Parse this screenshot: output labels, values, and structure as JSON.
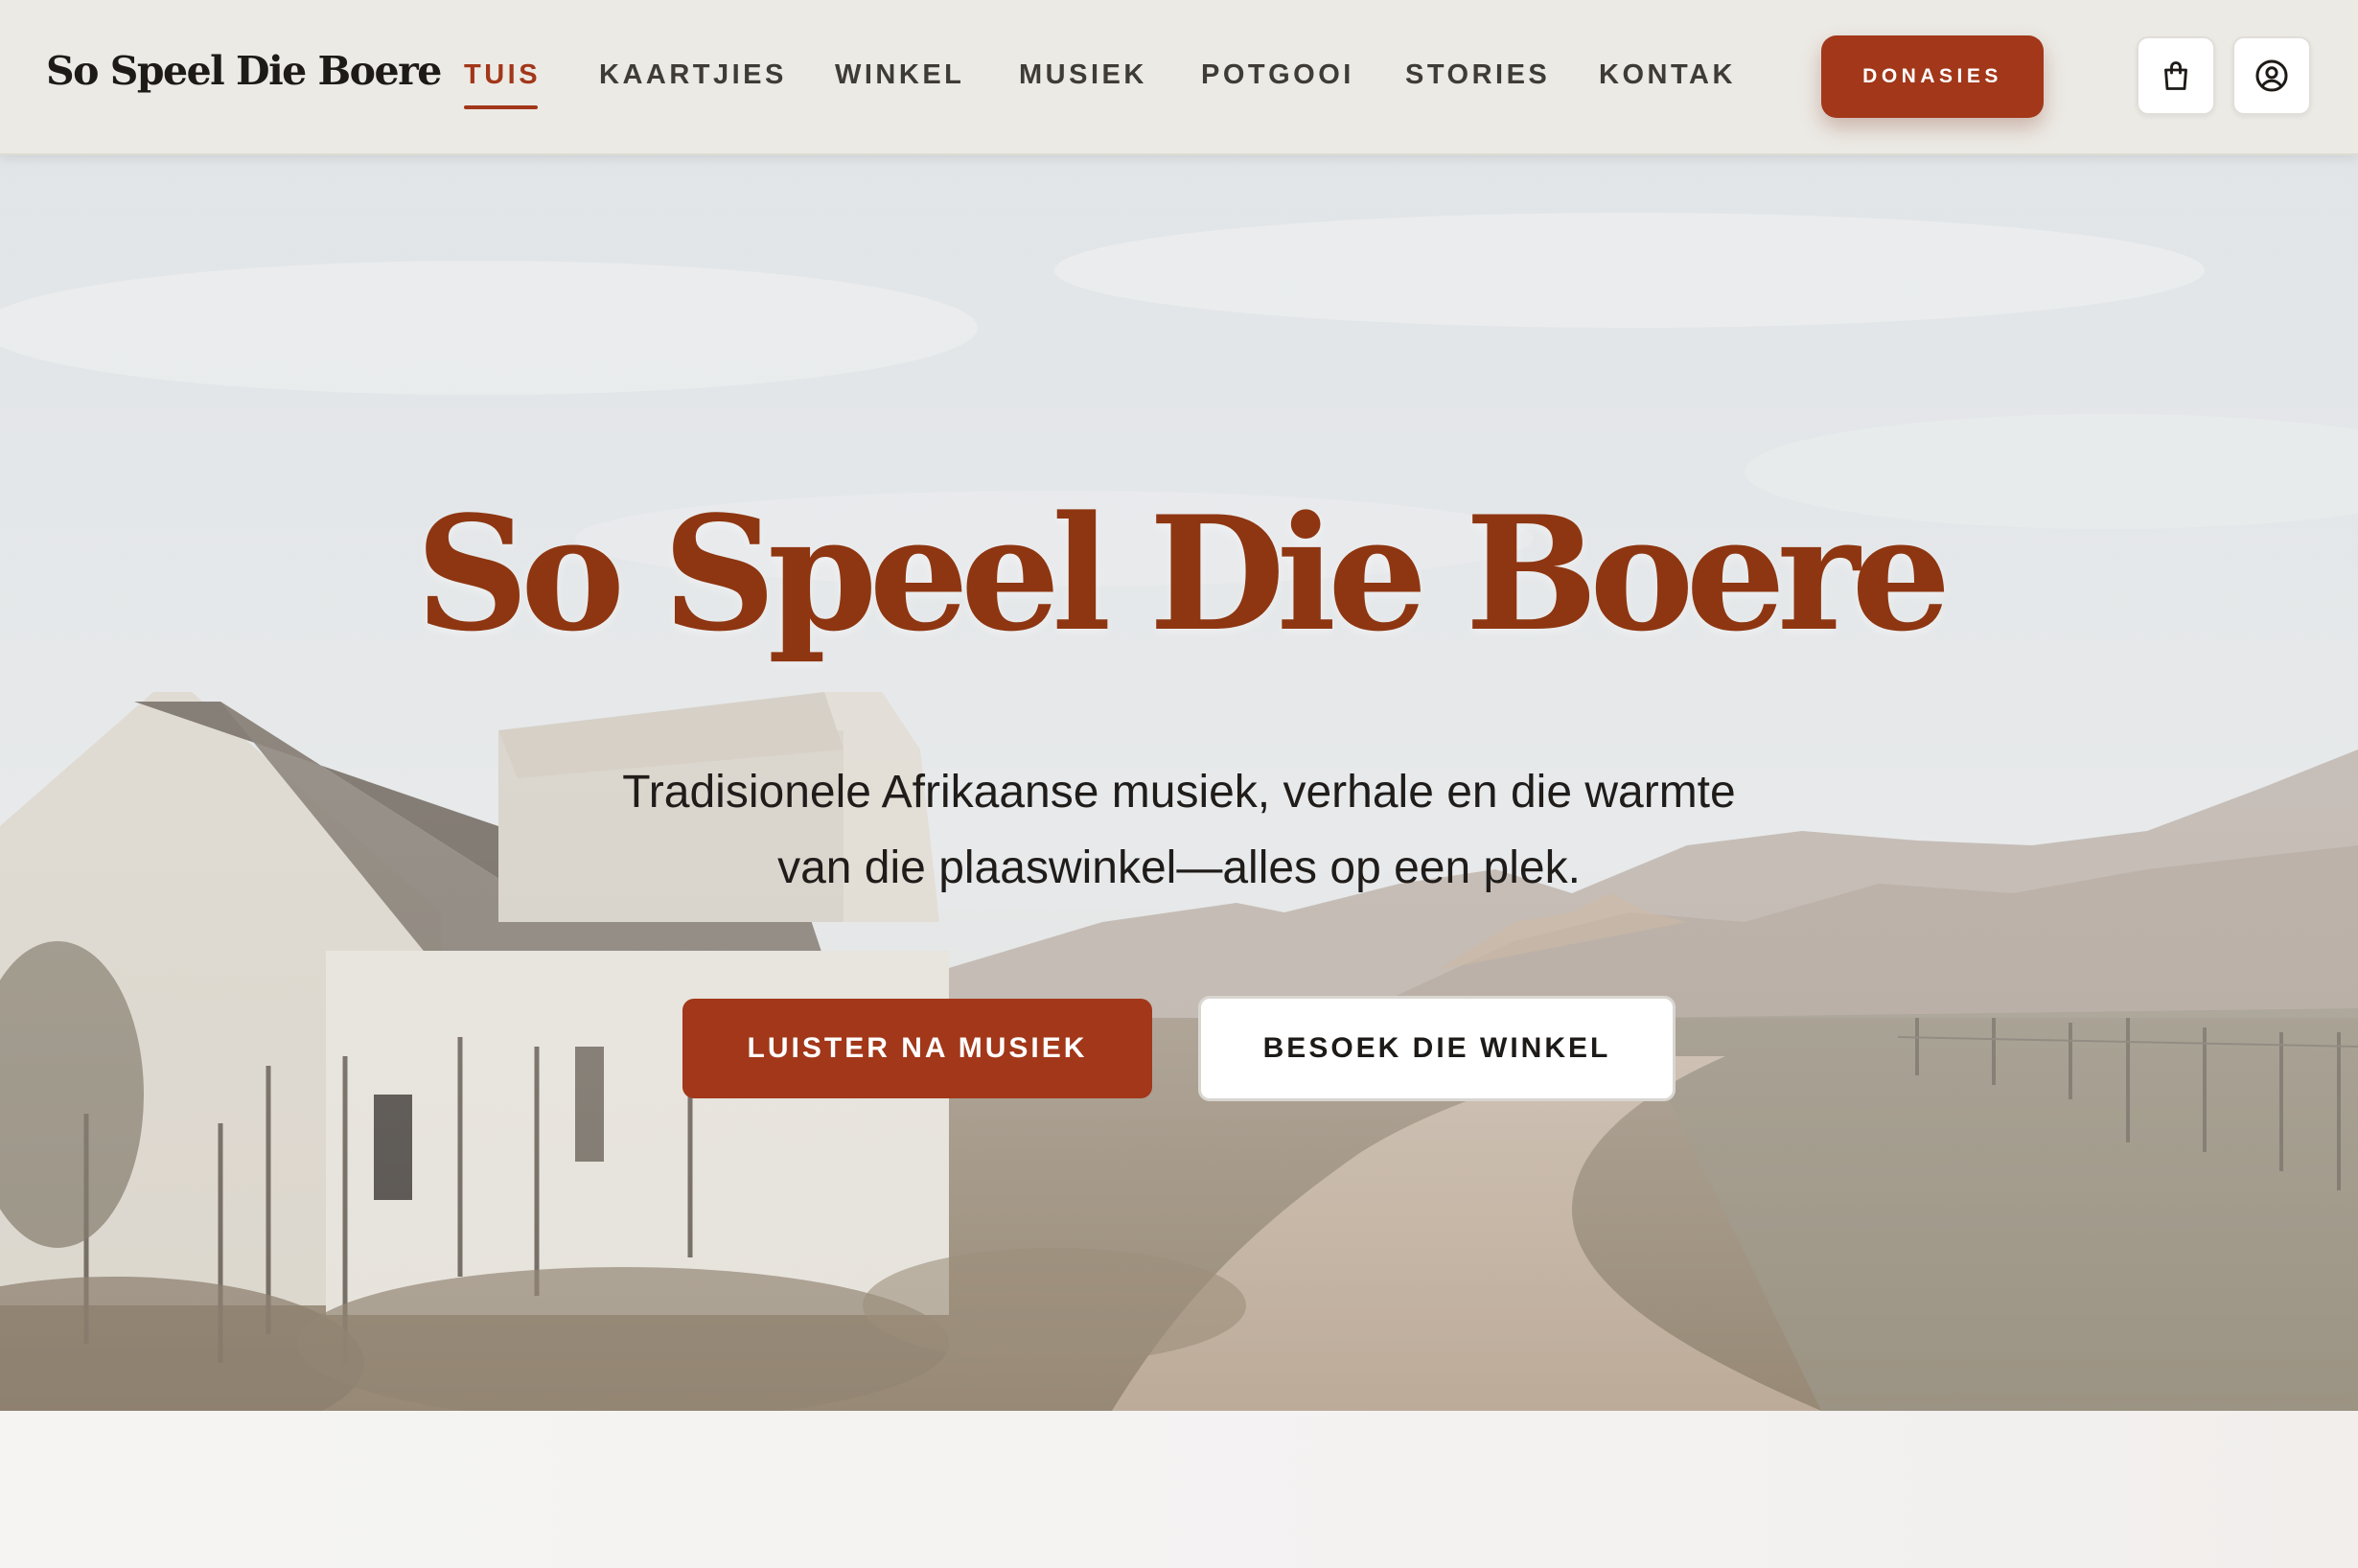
{
  "header": {
    "logo": "So Speel Die Boere",
    "nav": [
      {
        "label": "TUIS",
        "active": true
      },
      {
        "label": "KAARTJIES",
        "active": false
      },
      {
        "label": "WINKEL",
        "active": false
      },
      {
        "label": "MUSIEK",
        "active": false
      },
      {
        "label": "POTGOOI",
        "active": false
      },
      {
        "label": "STORIES",
        "active": false
      },
      {
        "label": "KONTAK",
        "active": false
      }
    ],
    "donate_label": "DONASIES",
    "icons": [
      "shopping-bag-icon",
      "user-account-icon"
    ]
  },
  "hero": {
    "title": "So Speel Die Boere",
    "subtitle_line1": "Tradisionele Afrikaanse musiek, verhale en die warmte",
    "subtitle_line2": "van die plaaswinkel—alles op een plek.",
    "primary_button": "LUISTER NA MUSIEK",
    "secondary_button": "BESOEK DIE WINKEL"
  },
  "colors": {
    "accent": "#a2371a",
    "title": "#8e3611",
    "header_bg": "#eceae5",
    "text_dark": "#1d1a17"
  }
}
